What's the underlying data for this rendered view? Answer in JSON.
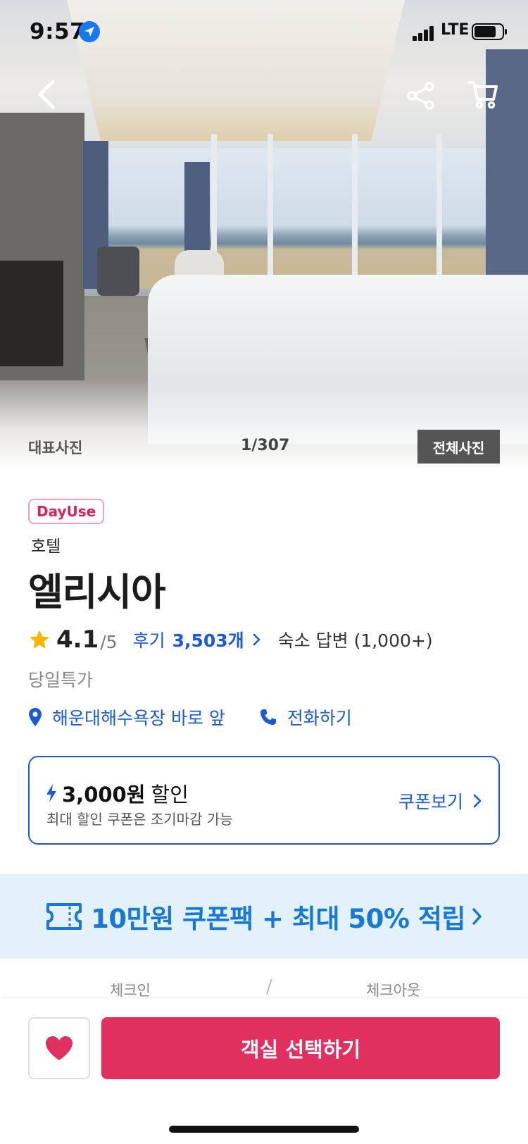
{
  "status_bar": {
    "time": "9:57",
    "network": "LTE",
    "battery_level": 0.78
  },
  "hero": {
    "label": "대표사진",
    "counter": "1/307",
    "all_photos_label": "전체사진"
  },
  "listing": {
    "badge": "DayUse",
    "category": "호텔",
    "name": "엘리시아",
    "rating": "4.1",
    "rating_max": "/5",
    "reviews_label": "후기",
    "reviews_count": "3,503개",
    "answers_label": "숙소 답변 (1,000+)",
    "deal_label": "당일특가",
    "location_label": "해운대해수욕장 바로 앞",
    "call_label": "전화하기"
  },
  "coupon": {
    "amount": "3,000원",
    "suffix": "할인",
    "note": "최대 할인 쿠폰은 조기마감 가능",
    "link_label": "쿠폰보기"
  },
  "promo": {
    "text": "10만원 쿠폰팩 + 최대 50% 적립"
  },
  "dates": {
    "checkin_label": "체크인",
    "checkout_label": "체크아웃"
  },
  "actions": {
    "select_room_label": "객실 선택하기"
  },
  "colors": {
    "accent_blue": "#1a5ad6",
    "accent_pink": "#e0305f",
    "badge_pink": "#d8245a",
    "promo_bg": "#e3f1fb",
    "star": "#f5b700"
  },
  "icons": [
    "location-arrow-icon",
    "back-icon",
    "share-icon",
    "cart-icon",
    "star-icon",
    "pin-icon",
    "phone-icon",
    "lightning-icon",
    "ticket-icon",
    "heart-icon"
  ]
}
